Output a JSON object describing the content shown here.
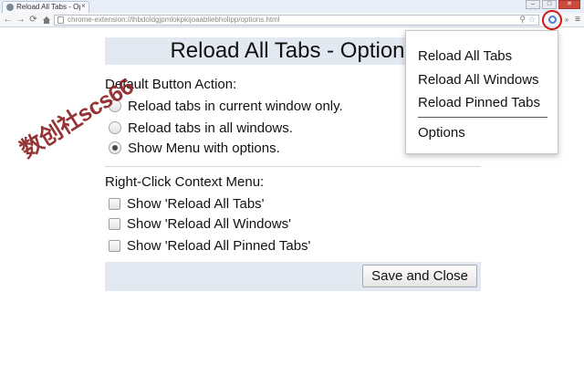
{
  "browser": {
    "tab_title": "Reload All Tabs - Op",
    "tab_close": "×",
    "window_controls": {
      "minimize": "–",
      "maximize": "□",
      "close": "✕"
    },
    "url": "chrome-extension://lhbdoldgjpmlokpkijoaabliebholipp/options.html",
    "nav_icons": {
      "back": "←",
      "forward": "→",
      "reload": "⟳",
      "home": "home-icon"
    },
    "omnibox_icons": [
      "page-icon",
      "zoom-icon",
      "star-icon"
    ],
    "extension_icon": "reload-all-tabs-icon",
    "extension_small": "»",
    "menu_icon": "≡",
    "highlight_color": "#d21414"
  },
  "page": {
    "title": "Reload All Tabs - Options",
    "default_action": {
      "label": "Default Button Action:",
      "options": [
        {
          "label": "Reload tabs in current window only.",
          "checked": false
        },
        {
          "label": "Reload tabs in all windows.",
          "checked": false
        },
        {
          "label": "Show Menu with options.",
          "checked": true
        }
      ]
    },
    "context_menu": {
      "label": "Right-Click Context Menu:",
      "options": [
        {
          "label": "Show 'Reload All Tabs'",
          "checked": false
        },
        {
          "label": "Show 'Reload All Windows'",
          "checked": false
        },
        {
          "label": "Show 'Reload All Pinned Tabs'",
          "checked": false
        }
      ]
    },
    "save_button": "Save and Close",
    "band_color": "#e2e9f3"
  },
  "dropdown": {
    "items": [
      "Reload All Tabs",
      "Reload All Windows",
      "Reload Pinned Tabs"
    ],
    "options": "Options"
  },
  "watermark": "数创社scs66"
}
